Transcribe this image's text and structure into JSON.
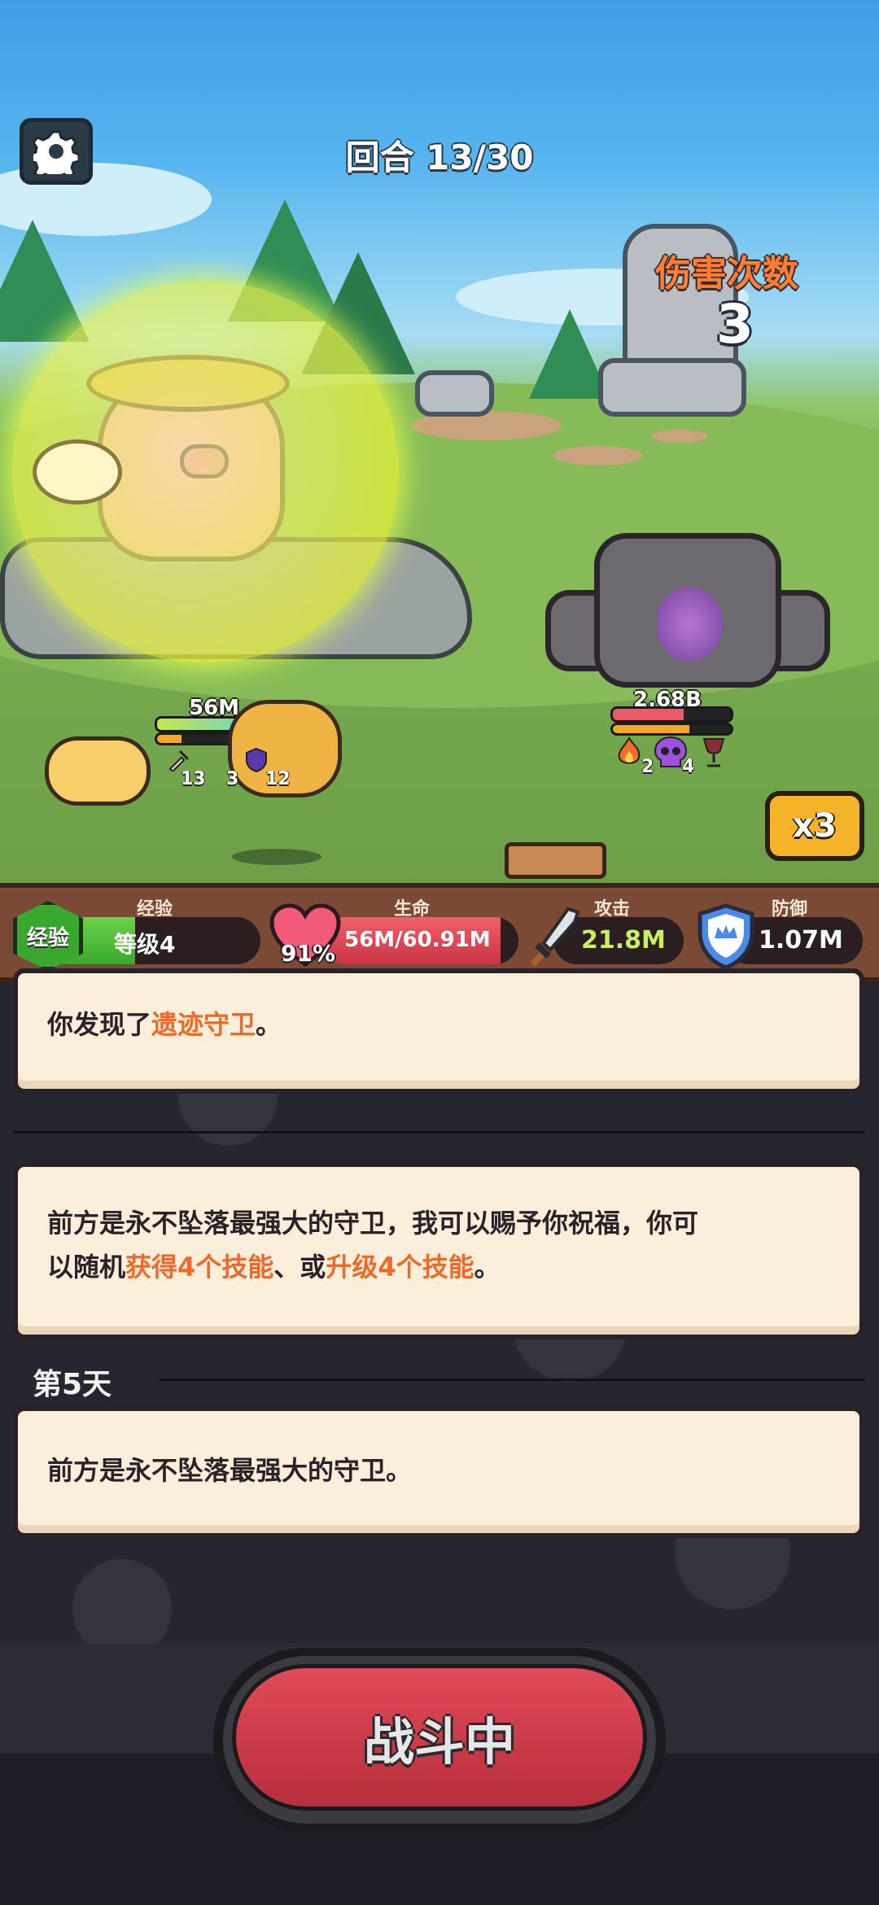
{
  "hud": {
    "round_text": "回合 13/30",
    "hits_label": "伤害次数",
    "hits_value": "3",
    "speed_label": "x3"
  },
  "battle": {
    "player_hp_label": "56M",
    "player_hp_fraction": 0.91,
    "player_status": [
      "13",
      "3",
      "12"
    ],
    "enemy_hp_label": "2.68B",
    "enemy_hp_fraction": 0.6,
    "enemy_status": [
      "2",
      "4"
    ]
  },
  "stats": {
    "exp_badge": "经验",
    "exp_caption": "经验",
    "level_text": "等级4",
    "exp_fraction": 0.45,
    "life_caption": "生命",
    "life_percent": "91%",
    "life_value": "56M/60.91M",
    "life_fraction": 0.91,
    "attack_caption": "攻击",
    "attack_value": "21.8M",
    "defense_caption": "防御",
    "defense_value": "1.07M"
  },
  "log": {
    "entry1_prefix": "你发现了",
    "entry1_highlight": "遗迹守卫",
    "entry1_suffix": "。",
    "entry2_line1": "前方是永不坠落最强大的守卫，我可以赐予你祝福，你可",
    "entry2_l2_a": "以随机",
    "entry2_l2_hl1": "获得4个技能",
    "entry2_l2_b": "、或",
    "entry2_l2_hl2": "升级4个技能",
    "entry2_l2_c": "。",
    "day_label": "第5天",
    "entry3": "前方是永不坠落最强大的守卫。"
  },
  "action": {
    "fight_label": "战斗中"
  },
  "colors": {
    "highlight": "#ec6a2a",
    "attack_text": "#c8f060",
    "hits_label": "#ff7e34"
  }
}
